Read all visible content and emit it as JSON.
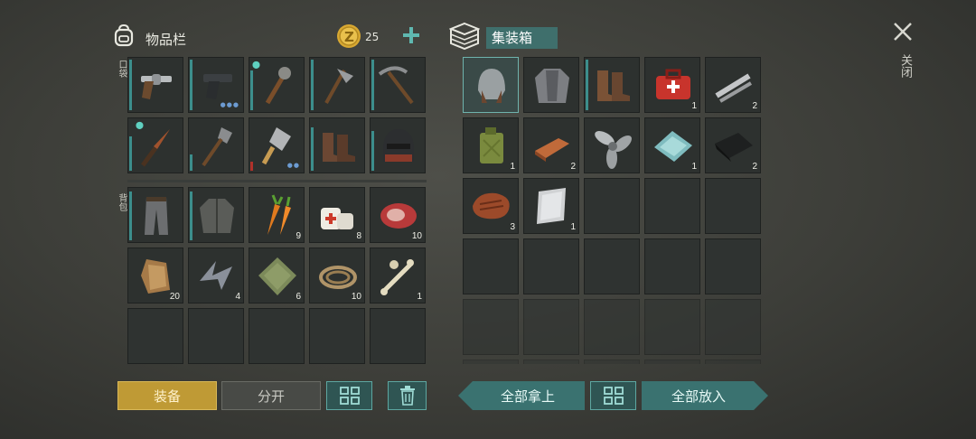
{
  "inventory": {
    "title": "物品栏",
    "coins": "25",
    "pocket_label": "口袋",
    "backpack_label": "背包",
    "pocket_items": [
      {
        "icon": "revolver-icon",
        "qty": ""
      },
      {
        "icon": "pistol-icon",
        "qty": ""
      },
      {
        "icon": "spiked-club-icon",
        "qty": ""
      },
      {
        "icon": "hatchet-icon",
        "qty": ""
      },
      {
        "icon": "pickaxe-icon",
        "qty": ""
      },
      {
        "icon": "knife-icon",
        "qty": ""
      },
      {
        "icon": "shovel-icon",
        "qty": ""
      },
      {
        "icon": "cleaver-icon",
        "qty": ""
      },
      {
        "icon": "boots-icon",
        "qty": ""
      },
      {
        "icon": "helmet-icon",
        "qty": ""
      }
    ],
    "backpack_items": [
      {
        "icon": "pants-icon",
        "qty": ""
      },
      {
        "icon": "jacket-icon",
        "qty": ""
      },
      {
        "icon": "carrot-icon",
        "qty": "9"
      },
      {
        "icon": "bandage-icon",
        "qty": "8"
      },
      {
        "icon": "meat-icon",
        "qty": "10"
      },
      {
        "icon": "fur-icon",
        "qty": "20"
      },
      {
        "icon": "metal-scraps-icon",
        "qty": "4"
      },
      {
        "icon": "cloth-icon",
        "qty": "6"
      },
      {
        "icon": "rope-icon",
        "qty": "10"
      },
      {
        "icon": "bones-icon",
        "qty": "1"
      }
    ]
  },
  "container": {
    "title": "集装箱",
    "items": [
      {
        "icon": "aviator-cap-icon",
        "qty": ""
      },
      {
        "icon": "leather-jacket-icon",
        "qty": ""
      },
      {
        "icon": "boots-icon",
        "qty": ""
      },
      {
        "icon": "first-aid-kit-icon",
        "qty": "1"
      },
      {
        "icon": "pipes-icon",
        "qty": "2"
      },
      {
        "icon": "jerrycan-icon",
        "qty": "1"
      },
      {
        "icon": "copper-ingot-icon",
        "qty": "2"
      },
      {
        "icon": "propeller-icon",
        "qty": ""
      },
      {
        "icon": "glass-icon",
        "qty": "1"
      },
      {
        "icon": "rubber-icon",
        "qty": "2"
      },
      {
        "icon": "steak-icon",
        "qty": "3"
      },
      {
        "icon": "metal-sheet-icon",
        "qty": "1"
      }
    ]
  },
  "buttons": {
    "equip": "装备",
    "split": "分开",
    "take_all": "全部拿上",
    "put_all": "全部放入"
  },
  "close_label": "关闭",
  "colors": {
    "accent": "#3a7270",
    "equip": "#bf9a35",
    "coin": "#e0b440"
  }
}
